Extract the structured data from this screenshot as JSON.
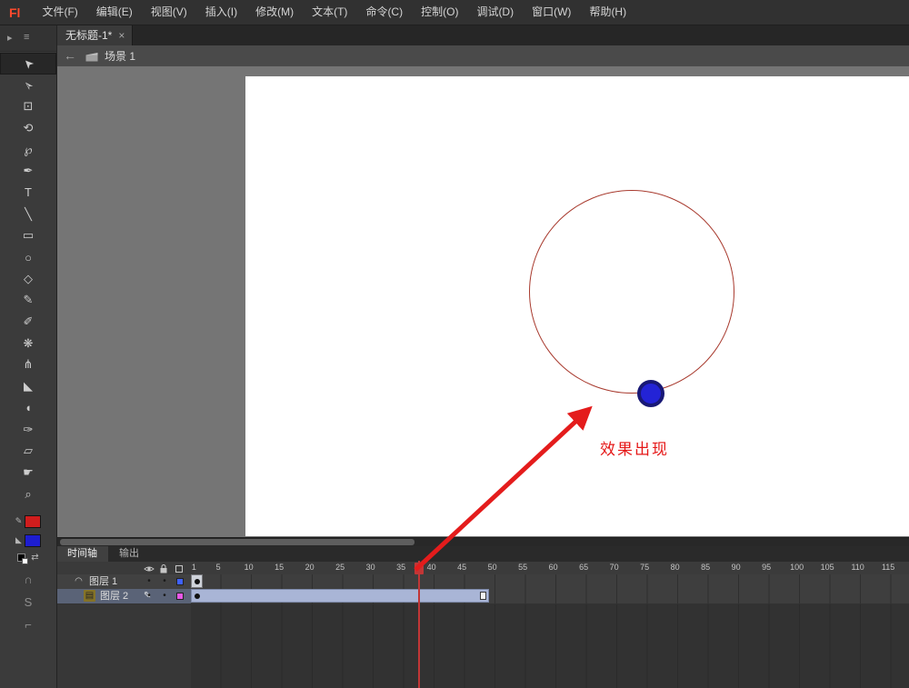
{
  "menubar": {
    "logo": "Fl",
    "items": [
      "文件(F)",
      "编辑(E)",
      "视图(V)",
      "插入(I)",
      "修改(M)",
      "文本(T)",
      "命令(C)",
      "控制(O)",
      "调试(D)",
      "窗口(W)",
      "帮助(H)"
    ]
  },
  "document_tab": {
    "title": "无标题-1*"
  },
  "scene_bar": {
    "scene_label": "场景 1"
  },
  "icons": {
    "panel_collapse": "▸",
    "panel_menu": "≡",
    "back": "←",
    "close": "×",
    "pencil_edit": "✎",
    "layer_page": "▤",
    "guide_arc": "◠",
    "dot": "•",
    "swap": "⇄",
    "stroke_pencil": "✎",
    "fill_bucket": "◣"
  },
  "tools": [
    {
      "name": "selection-tool",
      "glyph": "➤",
      "rot": true,
      "selected": true
    },
    {
      "name": "subselection-tool",
      "glyph": "➢",
      "rot": true
    },
    {
      "name": "free-transform-tool",
      "glyph": "⊡"
    },
    {
      "name": "3d-rotation-tool",
      "glyph": "⟲"
    },
    {
      "name": "lasso-tool",
      "glyph": "℘"
    },
    {
      "name": "pen-tool",
      "glyph": "✒"
    },
    {
      "name": "text-tool",
      "glyph": "T"
    },
    {
      "name": "line-tool",
      "glyph": "╲"
    },
    {
      "name": "rectangle-tool",
      "glyph": "▭"
    },
    {
      "name": "oval-tool",
      "glyph": "○"
    },
    {
      "name": "polystar-tool",
      "glyph": "◇"
    },
    {
      "name": "pencil-tool",
      "glyph": "✎"
    },
    {
      "name": "brush-tool",
      "glyph": "✐"
    },
    {
      "name": "deco-tool",
      "glyph": "❋"
    },
    {
      "name": "bone-tool",
      "glyph": "⋔"
    },
    {
      "name": "paint-bucket-tool",
      "glyph": "◣"
    },
    {
      "name": "ink-bottle-tool",
      "glyph": "◖"
    },
    {
      "name": "eyedropper-tool",
      "glyph": "✑"
    },
    {
      "name": "eraser-tool",
      "glyph": "▱"
    },
    {
      "name": "hand-tool",
      "glyph": "☛"
    },
    {
      "name": "zoom-tool",
      "glyph": "⌕"
    }
  ],
  "tool_options": [
    {
      "name": "snap-magnet-icon",
      "glyph": "∩"
    },
    {
      "name": "smooth-icon",
      "glyph": "S"
    },
    {
      "name": "straighten-icon",
      "glyph": "⌐"
    }
  ],
  "colors": {
    "stroke": "#cf1d1d",
    "fill": "#1d1dcf",
    "playhead": "#c23636",
    "arrow": "#e41c1c",
    "annotation": "#e51717",
    "circle": "#a83a2e",
    "ball_fill": "#2323d6",
    "ball_ring": "#181875"
  },
  "stage": {
    "annotation": "效果出现"
  },
  "timeline": {
    "tabs": [
      {
        "label": "时间轴",
        "active": true
      },
      {
        "label": "输出",
        "active": false
      }
    ],
    "ruler_labels": [
      1,
      5,
      10,
      15,
      20,
      25,
      30,
      35,
      40,
      45,
      50,
      55,
      60,
      65,
      70,
      75,
      80,
      85,
      90,
      95,
      100,
      105,
      110,
      115
    ],
    "playhead_frame": 38,
    "layers": [
      {
        "name": "图层 1",
        "selected": false,
        "editing": false,
        "icon": "guide",
        "indent": 0,
        "span_frames": 2,
        "span_color": "#cfd3da",
        "span_border": "#77787c",
        "outline_color": "#3f62ff"
      },
      {
        "name": "图层 2",
        "selected": true,
        "editing": true,
        "icon": "page",
        "indent": 1,
        "span_frames": 49,
        "span_color": "#a9b5d6",
        "span_border": "#7d89a9",
        "outline_color": "#e858e8"
      }
    ]
  }
}
